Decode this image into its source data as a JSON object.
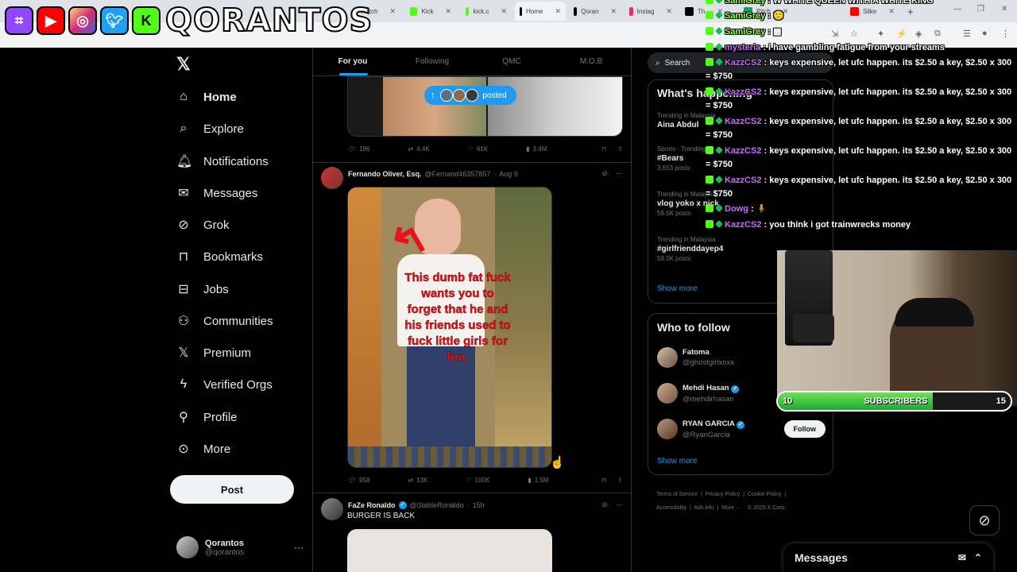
{
  "browser": {
    "tabs": [
      {
        "label": "Twitch",
        "icon": "twitch-icon",
        "color": "#9146ff",
        "active": false
      },
      {
        "label": "Kick",
        "icon": "kick-icon",
        "color": "#53fc18",
        "active": false
      },
      {
        "label": "kick.c",
        "icon": "kick-icon",
        "color": "#53fc18",
        "active": false
      },
      {
        "label": "Home",
        "icon": "x-icon",
        "color": "#000000",
        "active": true
      },
      {
        "label": "Qoran",
        "icon": "tiktok-icon",
        "color": "#000000",
        "active": false
      },
      {
        "label": "Instag",
        "icon": "instagram-icon",
        "color": "#e1306c",
        "active": false
      },
      {
        "label": "Th",
        "icon": "threads-icon",
        "color": "#000000",
        "active": false
      },
      {
        "label": "Pitch",
        "icon": "pitch-icon",
        "color": "#00a86b",
        "active": false
      },
      {
        "label": "Slike",
        "icon": "youtube-icon",
        "color": "#ff0000",
        "active": false
      }
    ],
    "new_tab": "+"
  },
  "overlay": {
    "channel_name": "QORANTOS",
    "socials": [
      "twitch",
      "youtube",
      "instagram",
      "twitter",
      "kick"
    ]
  },
  "nav": {
    "items": [
      {
        "label": "Home",
        "icon": "home-icon",
        "glyph": "⌂"
      },
      {
        "label": "Explore",
        "icon": "search-icon",
        "glyph": "⌕"
      },
      {
        "label": "Notifications",
        "icon": "bell-icon",
        "glyph": "🔔︎"
      },
      {
        "label": "Messages",
        "icon": "envelope-icon",
        "glyph": "✉"
      },
      {
        "label": "Grok",
        "icon": "grok-icon",
        "glyph": "⊘"
      },
      {
        "label": "Bookmarks",
        "icon": "bookmark-icon",
        "glyph": "⊓"
      },
      {
        "label": "Jobs",
        "icon": "briefcase-icon",
        "glyph": "⊟"
      },
      {
        "label": "Communities",
        "icon": "people-icon",
        "glyph": "⚇"
      },
      {
        "label": "Premium",
        "icon": "x-icon",
        "glyph": "𝕏"
      },
      {
        "label": "Verified Orgs",
        "icon": "lightning-icon",
        "glyph": "ϟ"
      },
      {
        "label": "Profile",
        "icon": "person-icon",
        "glyph": "⚲"
      },
      {
        "label": "More",
        "icon": "more-circle-icon",
        "glyph": "⊙"
      }
    ],
    "post_label": "Post",
    "account": {
      "name": "Qorantos",
      "handle": "@qorantos"
    }
  },
  "timeline": {
    "tabs": [
      "For you",
      "Following",
      "QMC",
      "M.O.B"
    ],
    "posted_pill": "posted",
    "first_actions": {
      "replies": "186",
      "reposts": "4.4K",
      "likes": "61K",
      "views": "3.4M"
    },
    "tweet1": {
      "name": "Fernando Oliver, Esq.",
      "handle": "@Fernand46357857",
      "date": "Aug 9",
      "image_text": "This dumb fat fuck wants you to forget that he and his friends used to fuck little girls for fun.",
      "actions": {
        "replies": "958",
        "reposts": "13K",
        "likes": "100K",
        "views": "1.5M"
      }
    },
    "tweet2": {
      "name": "FaZe Ronaldo",
      "handle": "@StableRonaldo",
      "date": "15h",
      "text": "BURGER IS BACK"
    }
  },
  "sidebar": {
    "search_placeholder": "Search",
    "trends_title": "What's happening",
    "trends": [
      {
        "context": "Trending in Malaysia",
        "name": "Aina Abdul",
        "count": ""
      },
      {
        "context": "Sports · Trending",
        "name": "#Bears",
        "count": "3,653 posts"
      },
      {
        "context": "Trending in Malaysia",
        "name": "vlog yoko x nick",
        "count": "59.5K posts"
      },
      {
        "context": "Trending in Malaysia",
        "name": "#girlfrienddayep4",
        "count": "59.5K posts"
      }
    ],
    "show_more": "Show more",
    "who_to_follow_title": "Who to follow",
    "who_to_follow": [
      {
        "name": "Fatoma",
        "handle": "@ghostgirlxoxx",
        "verified": false
      },
      {
        "name": "Mehdi Hasan",
        "handle": "@mehdirhasan",
        "verified": true
      },
      {
        "name": "RYAN GARCIA",
        "handle": "@RyanGarcia",
        "verified": true
      }
    ],
    "follow_label": "Follow",
    "footer": [
      "Terms of Service",
      "Privacy Policy",
      "Cookie Policy",
      "Accessibility",
      "Ads info",
      "More ···",
      "© 2025 X Corp."
    ]
  },
  "chat": {
    "lines": [
      {
        "user": "SamiGrey",
        "color": "#9aff4d",
        "text": "W WHITE QUEEN WITH A WHITE KING"
      },
      {
        "user": "SamiGrey",
        "color": "#9aff4d",
        "text": "🙂"
      },
      {
        "user": "SamiGrey",
        "color": "#9aff4d",
        "text": "▩"
      },
      {
        "user": "mysteria",
        "color": "#c86bff",
        "text": "i have gambling fatigue from your streams"
      },
      {
        "user": "KazzCS2",
        "color": "#c86bff",
        "text": "keys expensive, let ufc happen. its $2.50 a key, $2.50 x 300 = $750"
      },
      {
        "user": "KazzCS2",
        "color": "#c86bff",
        "text": "keys expensive, let ufc happen. its $2.50 a key, $2.50 x 300 = $750"
      },
      {
        "user": "KazzCS2",
        "color": "#c86bff",
        "text": "keys expensive, let ufc happen. its $2.50 a key, $2.50 x 300 = $750"
      },
      {
        "user": "KazzCS2",
        "color": "#c86bff",
        "text": "keys expensive, let ufc happen. its $2.50 a key, $2.50 x 300 = $750"
      },
      {
        "user": "KazzCS2",
        "color": "#c86bff",
        "text": "keys expensive, let ufc happen. its $2.50 a key, $2.50 x 300 = $750"
      },
      {
        "user": "Dowg",
        "color": "#c86bff",
        "text": "🧍"
      },
      {
        "user": "KazzCS2",
        "color": "#c86bff",
        "text": "you think i got trainwrecks money"
      }
    ]
  },
  "sub_goal": {
    "current": "10",
    "label": "SUBSCRIBERS",
    "target": "15",
    "progress": 0.6667
  },
  "messages_drawer": {
    "title": "Messages"
  }
}
